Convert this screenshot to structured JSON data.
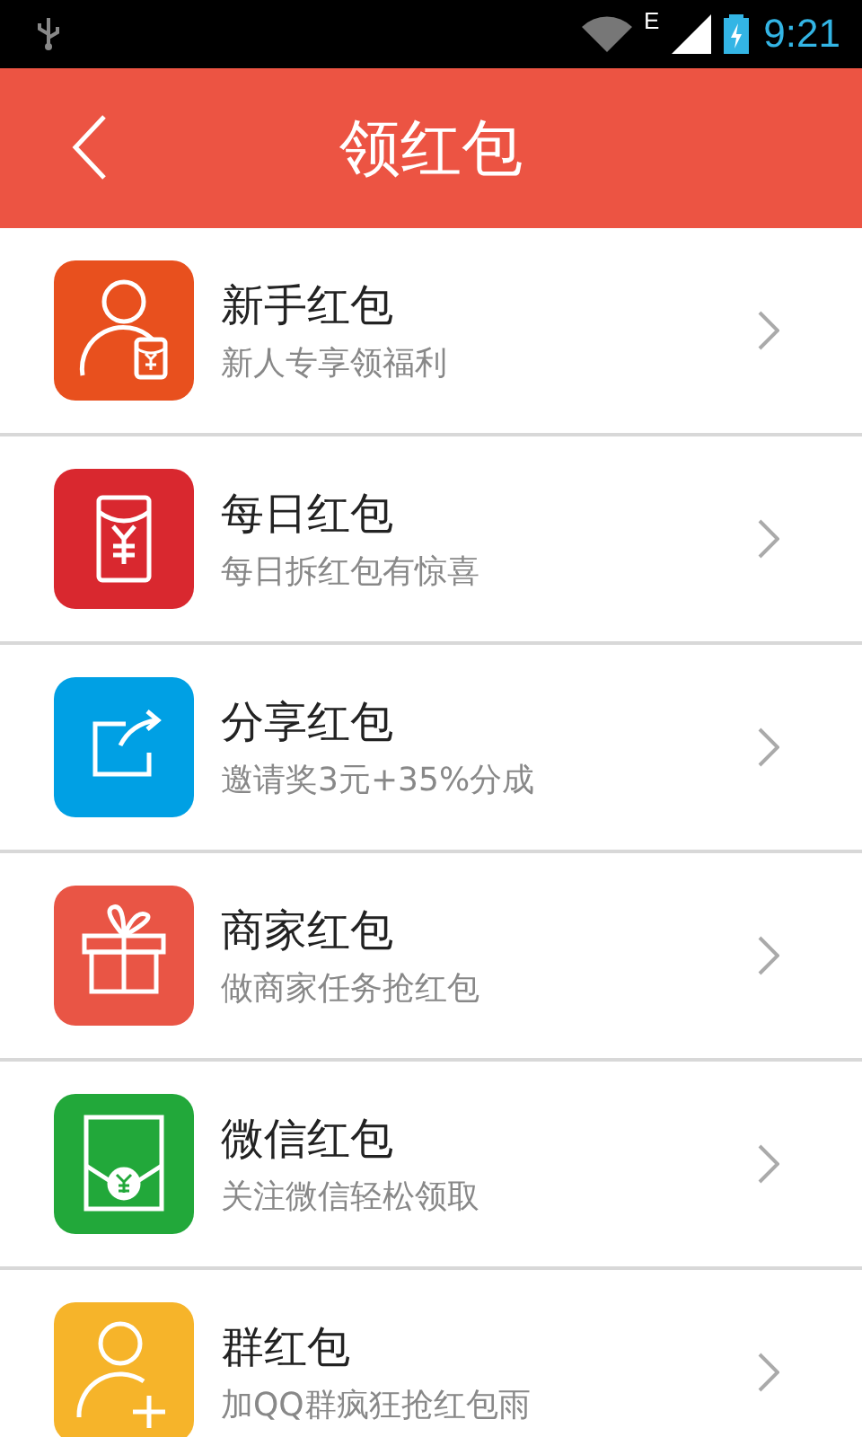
{
  "status_bar": {
    "network_type": "E",
    "time": "9:21"
  },
  "header": {
    "title": "领红包"
  },
  "items": [
    {
      "title": "新手红包",
      "subtitle": "新人专享领福利",
      "kind": "newcomer",
      "color": "#e8501e"
    },
    {
      "title": "每日红包",
      "subtitle": "每日拆红包有惊喜",
      "kind": "envelope",
      "color": "#d9282f"
    },
    {
      "title": "分享红包",
      "subtitle": "邀请奖3元+35%分成",
      "kind": "share",
      "color": "#00a0e4"
    },
    {
      "title": "商家红包",
      "subtitle": "做商家任务抢红包",
      "kind": "gift",
      "color": "#e95545"
    },
    {
      "title": "微信红包",
      "subtitle": "关注微信轻松领取",
      "kind": "wechat",
      "color": "#22a83a"
    },
    {
      "title": "群红包",
      "subtitle": "加QQ群疯狂抢红包雨",
      "kind": "group",
      "color": "#f6b42a"
    }
  ]
}
